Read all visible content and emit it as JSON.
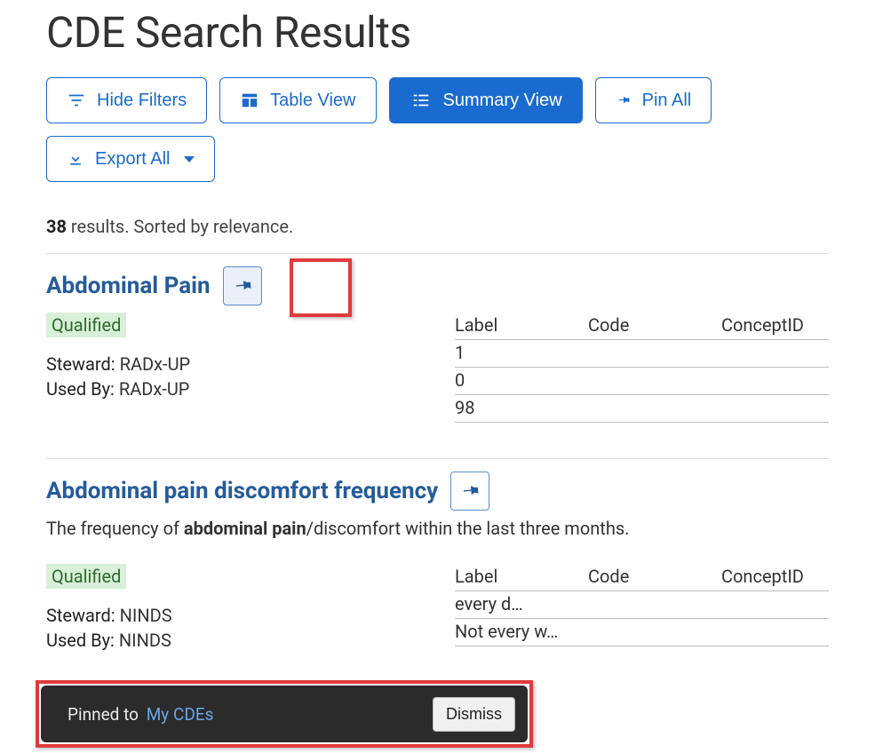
{
  "title": "CDE Search Results",
  "toolbar": {
    "hide_filters": "Hide Filters",
    "table_view": "Table View",
    "summary_view": "Summary View",
    "pin_all": "Pin All",
    "export_all": "Export All"
  },
  "results": {
    "count": "38",
    "sorted_text": " results. Sorted by relevance."
  },
  "items": [
    {
      "title": "Abdominal Pain",
      "status": "Qualified",
      "steward_label": "Steward:",
      "steward_value": "RADx-UP",
      "usedby_label": "Used By:",
      "usedby_value": "RADx-UP",
      "table_headers": {
        "label": "Label",
        "code": "Code",
        "concept": "ConceptID"
      },
      "rows": [
        {
          "label": "1",
          "code": "",
          "concept": ""
        },
        {
          "label": "0",
          "code": "",
          "concept": ""
        },
        {
          "label": "98",
          "code": "",
          "concept": ""
        }
      ]
    },
    {
      "title": "Abdominal pain discomfort frequency",
      "description_pre": "The frequency of ",
      "description_bold": "abdominal pain",
      "description_post": "/discomfort within the last three months.",
      "status": "Qualified",
      "steward_label": "Steward:",
      "steward_value": "NINDS",
      "usedby_label": "Used By:",
      "usedby_value": "NINDS",
      "table_headers": {
        "label": "Label",
        "code": "Code",
        "concept": "ConceptID"
      },
      "rows": [
        {
          "label": "every d…",
          "code": "",
          "concept": ""
        },
        {
          "label": "Not every w…",
          "code": "",
          "concept": ""
        }
      ]
    }
  ],
  "toast": {
    "text": "Pinned to",
    "link": "My CDEs",
    "dismiss": "Dismiss"
  }
}
